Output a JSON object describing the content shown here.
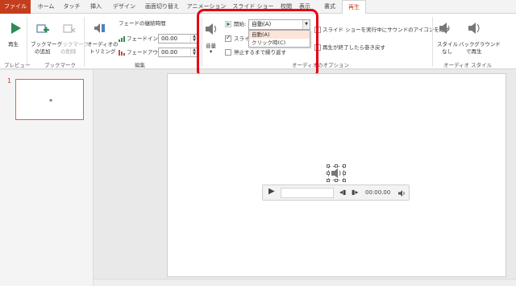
{
  "tabs": {
    "file": "ファイル",
    "home": "ホーム",
    "touch": "タッチ",
    "insert": "挿入",
    "design": "デザイン",
    "transitions": "画面切り替え",
    "animations": "アニメーション",
    "slideshow": "スライド ショー",
    "review": "校閲",
    "view": "表示",
    "format": "書式",
    "playback": "再生"
  },
  "preview_group": {
    "play_label": "再生",
    "group_label": "プレビュー"
  },
  "bookmark_group": {
    "add_label_1": "ブックマーク",
    "add_label_2": "の追加",
    "remove_label_1": "ブックマーク",
    "remove_label_2": "の削除",
    "group_label": "ブックマーク"
  },
  "edit_group": {
    "trim_label_1": "オーディオの",
    "trim_label_2": "トリミング",
    "fade_duration_title": "フェードの継続時間",
    "fade_in_label": "フェードイン:",
    "fade_in_value": "00.00",
    "fade_out_label": "フェードアウト:",
    "fade_out_value": "00.00",
    "group_label": "編集"
  },
  "audio_options": {
    "volume_label": "音量",
    "start_label": "開始:",
    "start_value": "自動(A)",
    "start_options": [
      "自動(A)",
      "クリック時(C)"
    ],
    "across_slides_label": "スライド",
    "loop_label": "停止するまで繰り返す",
    "hide_during_show_label": "スライド ショーを実行中にサウンドのアイコンを隠す",
    "rewind_label": "再生が終了したら巻き戻す",
    "group_label": "オーディオのオプション"
  },
  "audio_styles": {
    "no_style_label_1": "スタイル",
    "no_style_label_2": "なし",
    "background_label_1": "バックグラウンド",
    "background_label_2": "で再生",
    "group_label": "オーディオ スタイル"
  },
  "slides": {
    "current_number": "1"
  },
  "player": {
    "time": "00:00.00"
  },
  "colors": {
    "accent": "#c43e1c",
    "highlight": "#e60012",
    "play_green": "#2e8b57"
  }
}
